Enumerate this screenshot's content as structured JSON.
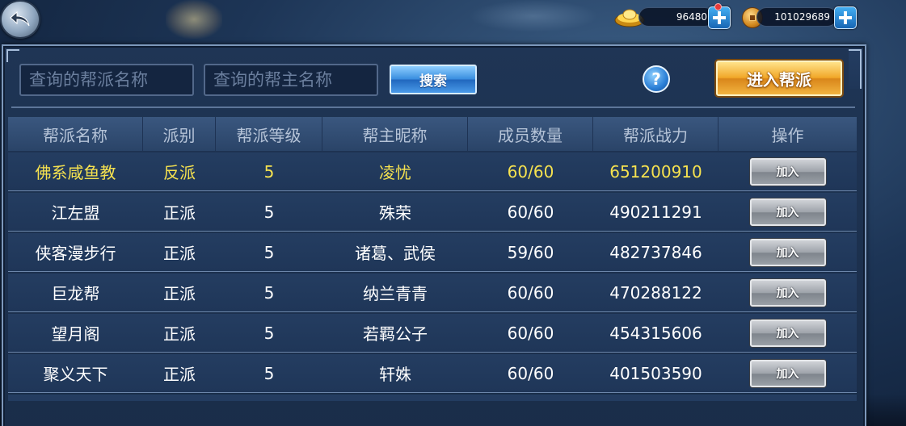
{
  "currency": {
    "gold_ingot": "96480",
    "copper_coin": "101029689"
  },
  "search": {
    "guild_name_placeholder": "查询的帮派名称",
    "leader_name_placeholder": "查询的帮主名称",
    "search_label": "搜索",
    "help_label": "?",
    "enter_guild_label": "进入帮派"
  },
  "table": {
    "headers": [
      "帮派名称",
      "派别",
      "帮派等级",
      "帮主昵称",
      "成员数量",
      "帮派战力",
      "操作"
    ],
    "rows": [
      {
        "name": "佛系咸鱼教",
        "faction": "反派",
        "level": "5",
        "leader": "凌忧",
        "members": "60/60",
        "power": "651200910",
        "action": "加入"
      },
      {
        "name": "江左盟",
        "faction": "正派",
        "level": "5",
        "leader": "殊荣",
        "members": "60/60",
        "power": "490211291",
        "action": "加入"
      },
      {
        "name": "侠客漫步行",
        "faction": "正派",
        "level": "5",
        "leader": "诸葛、武侯",
        "members": "59/60",
        "power": "482737846",
        "action": "加入"
      },
      {
        "name": "巨龙帮",
        "faction": "正派",
        "level": "5",
        "leader": "纳兰青青",
        "members": "60/60",
        "power": "470288122",
        "action": "加入"
      },
      {
        "name": "望月阁",
        "faction": "正派",
        "level": "5",
        "leader": "若羁公子",
        "members": "60/60",
        "power": "454315606",
        "action": "加入"
      },
      {
        "name": "聚义天下",
        "faction": "正派",
        "level": "5",
        "leader": "轩姝",
        "members": "60/60",
        "power": "401503590",
        "action": "加入"
      }
    ]
  },
  "colors": {
    "highlight_row_text": "#f6e24f",
    "normal_row_text": "#ffffff",
    "panel_bg": "#1f3555"
  },
  "icons": {
    "back": "back-arrow-icon",
    "gold": "gold-ingot-icon",
    "coin": "copper-coin-icon",
    "add": "plus-icon",
    "help": "question-mark-icon"
  }
}
